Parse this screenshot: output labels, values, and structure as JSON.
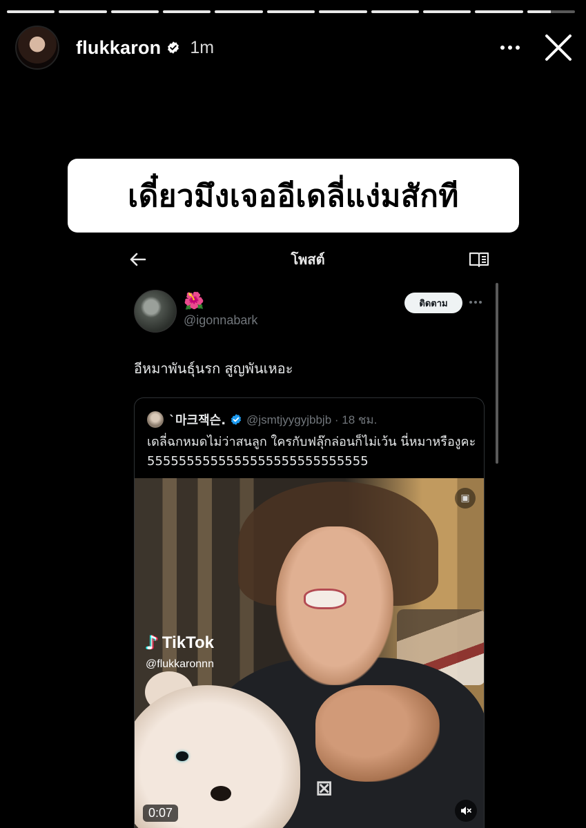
{
  "story": {
    "progress": [
      1,
      1,
      1,
      1,
      1,
      1,
      1,
      1,
      1,
      1,
      0.5
    ],
    "username": "flukkaron",
    "verified": true,
    "time": "1m"
  },
  "caption": "เดี๋ยวมึงเจออีเดลี่แง่มสักที",
  "screenshot": {
    "bar_title": "โพสต์",
    "tweet": {
      "emoji": "🌺",
      "handle": "@igonnabark",
      "follow_label": "ติดตาม",
      "text": "อีหมาพันธุ์นรก สูญพันเหอะ",
      "quote": {
        "name": "`마크잭슨.",
        "handle": "@jsmtjyygyjbbjb · 18 ชม.",
        "text": "เดลี่ฉกหมดไม่ว่าสนลูก ใครกับฟลุ๊กล่อนก็ไม่เว้น นี่หมาหรืองูคะ 5555555555555555555555555555",
        "video": {
          "watermark_brand": "TikTok",
          "watermark_user": "@flukkaronnn",
          "duration": "0:07"
        }
      }
    }
  },
  "colors": {
    "background": "#000000",
    "verified_blue": "#1d9bf0",
    "muted_text": "#71767b"
  }
}
